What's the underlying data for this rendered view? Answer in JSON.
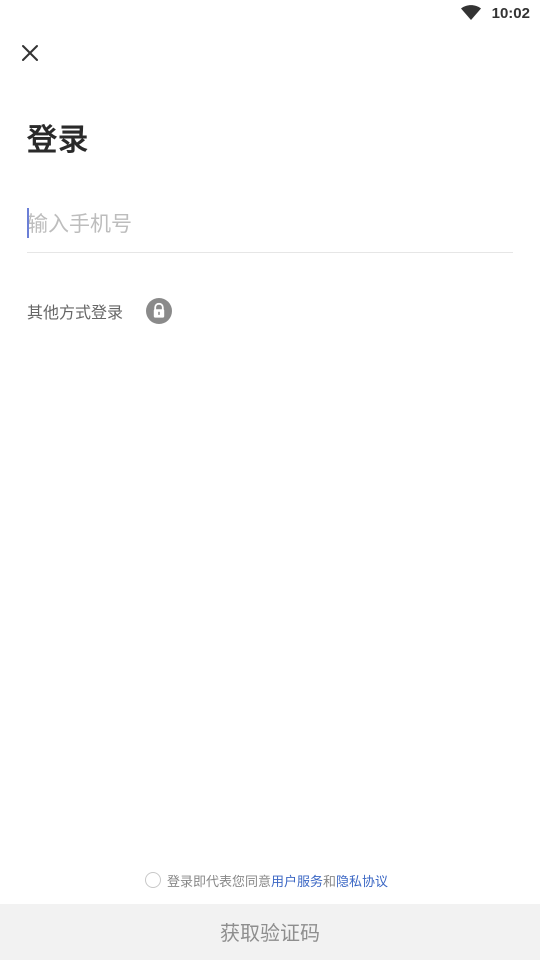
{
  "status_bar": {
    "time": "10:02",
    "wifi_icon": "wifi-icon"
  },
  "header": {
    "close_icon": "close-icon"
  },
  "login": {
    "title": "登录",
    "phone_placeholder": "输入手机号",
    "phone_value": "",
    "other_methods_label": "其他方式登录",
    "other_methods_icon": "lock-icon"
  },
  "agreement": {
    "checked": false,
    "prefix": "登录即代表您同意",
    "service_link": "用户服务",
    "conjunction": "和",
    "privacy_link": "隐私协议"
  },
  "footer": {
    "submit_label": "获取验证码"
  },
  "colors": {
    "link": "#3b67c4",
    "caret": "#6b7fd6",
    "button_bg": "#f2f2f2",
    "button_text": "#8e8e8e"
  }
}
